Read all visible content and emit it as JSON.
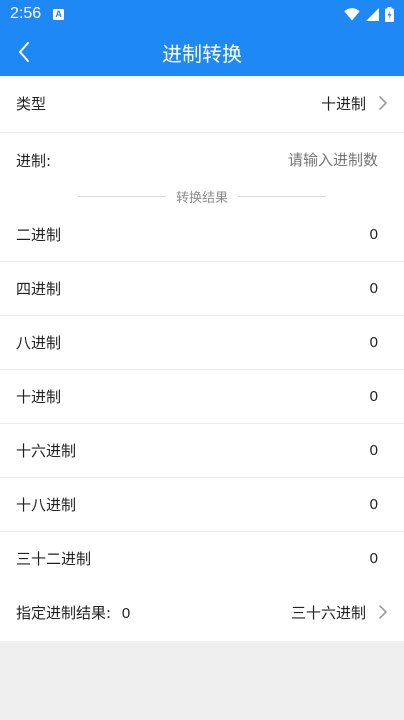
{
  "status": {
    "time": "2:56",
    "notif_icon": "A"
  },
  "app_bar": {
    "title": "进制转换",
    "back_icon": "chevron-left-icon"
  },
  "type_row": {
    "label": "类型",
    "value": "十进制"
  },
  "input_row": {
    "label": "进制:",
    "placeholder": "请输入进制数"
  },
  "section": {
    "title": "转换结果"
  },
  "results": [
    {
      "label": "二进制",
      "value": "0"
    },
    {
      "label": "四进制",
      "value": "0"
    },
    {
      "label": "八进制",
      "value": "0"
    },
    {
      "label": "十进制",
      "value": "0"
    },
    {
      "label": "十六进制",
      "value": "0"
    },
    {
      "label": "十八进制",
      "value": "0"
    },
    {
      "label": "三十二进制",
      "value": "0"
    }
  ],
  "custom_row": {
    "label": "指定进制结果:",
    "result": "0",
    "selector": "三十六进制"
  },
  "colors": {
    "primary": "#1e88f5",
    "background": "#efefef",
    "surface": "#ffffff"
  }
}
